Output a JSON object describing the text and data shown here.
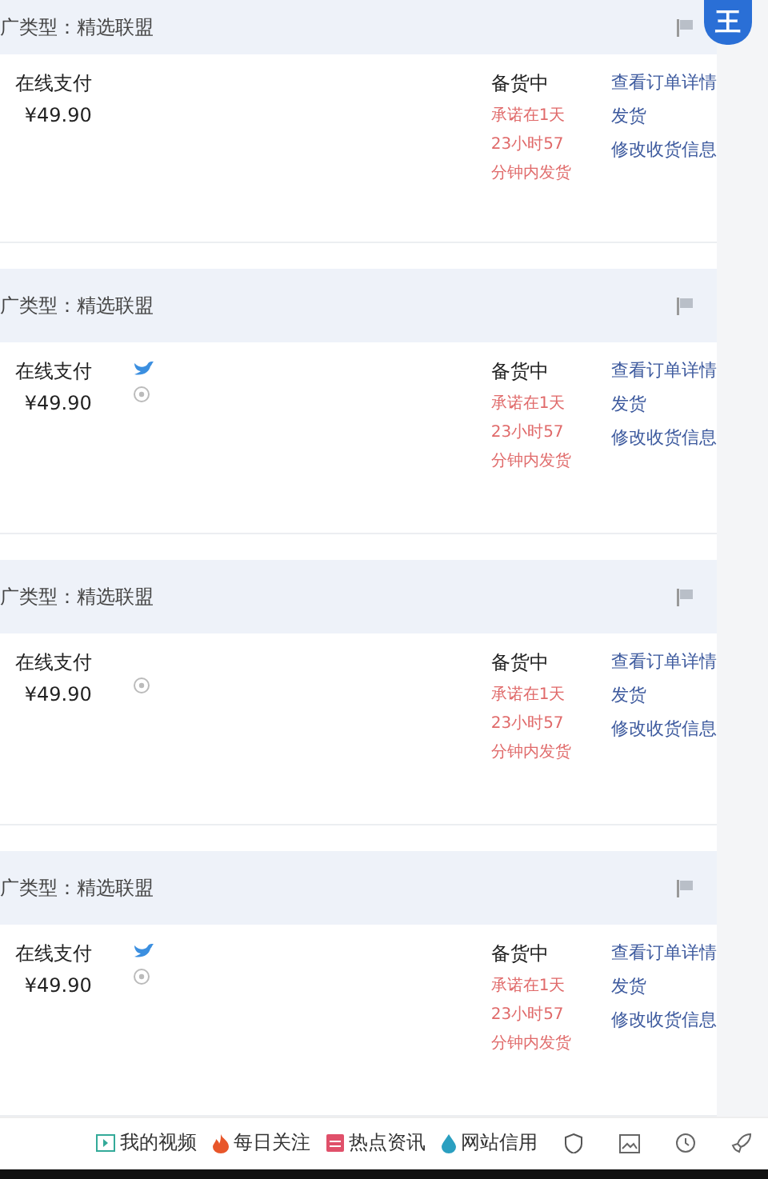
{
  "top_badge": "王",
  "orders": [
    {
      "header": "广类型：精选联盟",
      "payment": "在线支付",
      "price": "¥49.90",
      "buyer_icons": false,
      "location_icon": false,
      "status": "备货中",
      "promise": "承诺在1天23小时57分钟内发货",
      "actions": [
        "查看订单详情",
        "发货",
        "修改收货信息"
      ]
    },
    {
      "header": "广类型：精选联盟",
      "payment": "在线支付",
      "price": "¥49.90",
      "buyer_icons": true,
      "location_icon": true,
      "status": "备货中",
      "promise": "承诺在1天23小时57分钟内发货",
      "actions": [
        "查看订单详情",
        "发货",
        "修改收货信息"
      ]
    },
    {
      "header": "广类型：精选联盟",
      "payment": "在线支付",
      "price": "¥49.90",
      "buyer_icons": false,
      "location_icon": true,
      "status": "备货中",
      "promise": "承诺在1天23小时57分钟内发货",
      "actions": [
        "查看订单详情",
        "发货",
        "修改收货信息"
      ]
    },
    {
      "header": "广类型：精选联盟",
      "payment": "在线支付",
      "price": "¥49.90",
      "buyer_icons": true,
      "location_icon": true,
      "status": "备货中",
      "promise": "承诺在1天23小时57分钟内发货",
      "actions": [
        "查看订单详情",
        "发货",
        "修改收货信息"
      ]
    }
  ],
  "bottom_bar": [
    {
      "kind": "video",
      "label": "我的视频"
    },
    {
      "kind": "fire",
      "label": "每日关注"
    },
    {
      "kind": "news",
      "label": "热点资讯"
    },
    {
      "kind": "drop",
      "label": "网站信用"
    },
    {
      "kind": "shield"
    },
    {
      "kind": "image"
    },
    {
      "kind": "clock"
    },
    {
      "kind": "rocket"
    }
  ]
}
